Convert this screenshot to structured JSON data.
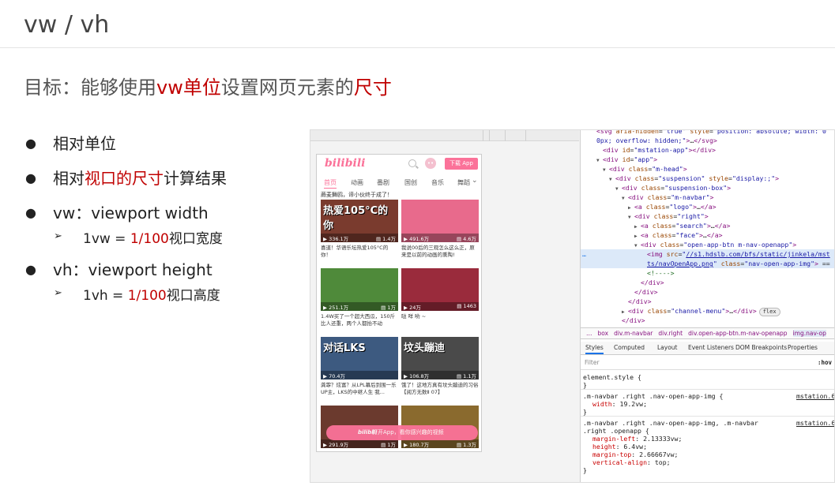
{
  "slide": {
    "title": "vw / vh",
    "goal": {
      "prefix": "目标：能够使用",
      "red1": "vw单位",
      "mid": "设置网页元素的",
      "red2": "尺寸"
    },
    "bullets": [
      {
        "dot": "●",
        "text": "相对单位"
      },
      {
        "dot": "●",
        "pre": "相对",
        "red": "视口的尺寸",
        "post": "计算结果"
      },
      {
        "dot": "●",
        "text": "vw：viewport width",
        "sub": {
          "arrow": "➢",
          "pre": "1vw = ",
          "red": "1/100",
          "post": "视口宽度"
        }
      },
      {
        "dot": "●",
        "text": "vh：viewport height",
        "sub": {
          "arrow": "➢",
          "pre": "1vh = ",
          "red": "1/100",
          "post": "视口高度"
        }
      }
    ]
  },
  "phone": {
    "logo": "bilibili",
    "face": "••",
    "download": "下载 App",
    "nav": [
      "首页",
      "动画",
      "番剧",
      "国创",
      "音乐",
      "舞蹈"
    ],
    "top_caption": "蕨麦舞鸥，谛小伙终于成了！",
    "cards": [
      {
        "big": "热爱105°C的你",
        "plays": "336.1万",
        "comments": "1.4万",
        "desc": "喜道！华语乐坛热爱105°C的你！",
        "bg": "#7a3b2e"
      },
      {
        "big": "",
        "plays": "491.6万",
        "comments": "4.6万",
        "desc": "我说00后的三观怎么这么正，原来是以前的动画的熏陶!",
        "bg": "#e86a8c"
      },
      {
        "big": "",
        "plays": "251.1万",
        "comments": "1万",
        "desc": "1.4W买了一个超大西瓜，150斤比人还重，两个人都抬不动",
        "bg": "#4f8a3a"
      },
      {
        "big": "",
        "plays": "24万",
        "comments": "1463",
        "desc": "哒 咩 哟 ~",
        "bg": "#9a2b3c"
      },
      {
        "big": "对话LKS",
        "plays": "70.4万",
        "comments": "",
        "desc": "龚霏？炫富？从LPL幕后到围一乐UP主，LKS的中继人生 我...",
        "bg": "#3d5a80"
      },
      {
        "big": "坟头蹦迪",
        "plays": "106.8万",
        "comments": "1.1万",
        "desc": "饿了！这地方真有坟头蹦迪的习俗【阅方无数Ⅱ 07】",
        "bg": "#4a4a4a"
      },
      {
        "big": "",
        "plays": "291.9万",
        "comments": "1万",
        "desc": "",
        "bg": "#6b3a2e"
      },
      {
        "big": "",
        "plays": "180.7万",
        "comments": "1.3万",
        "desc": "",
        "bg": "#8a6a2e"
      }
    ],
    "open_app": {
      "logo": "bilibili",
      "text": "打开App，看你感兴趣的视频"
    }
  },
  "devtools": {
    "tree_lines": [
      {
        "indent": 1,
        "html": "<span class='tag'>&lt;svg</span> <span class='an'>aria-hidden</span>=<span class='av'>\"true\"</span> <span class='an'>style</span>=<span class='av'>\"position: absolute; width: 0</span>"
      },
      {
        "indent": 1,
        "html": "<span class='av'>0px; overflow: hidden;\"</span><span class='tag'>&gt;</span>…<span class='tag'>&lt;/svg&gt;</span>"
      },
      {
        "indent": 2,
        "html": "<span class='tag'>&lt;div</span> <span class='an'>id</span>=<span class='av'>\"mstation-app\"</span><span class='tag'>&gt;&lt;/div&gt;</span>"
      },
      {
        "indent": 2,
        "tri": "▼",
        "html": "<span class='tag'>&lt;div</span> <span class='an'>id</span>=<span class='av'>\"app\"</span><span class='tag'>&gt;</span>"
      },
      {
        "indent": 3,
        "tri": "▼",
        "html": "<span class='tag'>&lt;div</span> <span class='an'>class</span>=<span class='av'>\"m-head\"</span><span class='tag'>&gt;</span>"
      },
      {
        "indent": 4,
        "tri": "▼",
        "html": "<span class='tag'>&lt;div</span> <span class='an'>class</span>=<span class='av'>\"suspension\"</span> <span class='an'>style</span>=<span class='av'>\"display:;\"</span><span class='tag'>&gt;</span>"
      },
      {
        "indent": 5,
        "tri": "▼",
        "html": "<span class='tag'>&lt;div</span> <span class='an'>class</span>=<span class='av'>\"suspension-box\"</span><span class='tag'>&gt;</span>"
      },
      {
        "indent": 6,
        "tri": "▼",
        "html": "<span class='tag'>&lt;div</span> <span class='an'>class</span>=<span class='av'>\"m-navbar\"</span><span class='tag'>&gt;</span>"
      },
      {
        "indent": 7,
        "tri": "▶",
        "html": "<span class='tag'>&lt;a</span> <span class='an'>class</span>=<span class='av'>\"logo\"</span><span class='tag'>&gt;</span>…<span class='tag'>&lt;/a&gt;</span>"
      },
      {
        "indent": 7,
        "tri": "▼",
        "html": "<span class='tag'>&lt;div</span> <span class='an'>class</span>=<span class='av'>\"right\"</span><span class='tag'>&gt;</span>"
      },
      {
        "indent": 8,
        "tri": "▶",
        "html": "<span class='tag'>&lt;a</span> <span class='an'>class</span>=<span class='av'>\"search\"</span><span class='tag'>&gt;</span>…<span class='tag'>&lt;/a&gt;</span>"
      },
      {
        "indent": 8,
        "tri": "▶",
        "html": "<span class='tag'>&lt;a</span> <span class='an'>class</span>=<span class='av'>\"face\"</span><span class='tag'>&gt;</span>…<span class='tag'>&lt;/a&gt;</span>"
      },
      {
        "indent": 8,
        "tri": "▼",
        "html": "<span class='tag'>&lt;div</span> <span class='an'>class</span>=<span class='av'>\"open-app-btn m-nav-openapp\"</span><span class='tag'>&gt;</span>"
      },
      {
        "indent": 9,
        "sel": true,
        "html": "<span class='tag'>&lt;img</span> <span class='an'>src</span>=<span class='av'>\"<span class='url'>//s1.hdslb.com/bfs/static/jinkela/mst</span></span>"
      },
      {
        "indent": 9,
        "sel": true,
        "html": "<span class='url'>ts/navOpenApp.png</span><span class='av'>\"</span> <span class='an'>class</span>=<span class='av'>\"nav-open-app-img\"</span><span class='tag'>&gt;</span> == $0"
      },
      {
        "indent": 9,
        "html": "<span class='cmt'>&lt;!----&gt;</span>"
      },
      {
        "indent": 8,
        "html": "<span class='tag'>&lt;/div&gt;</span>"
      },
      {
        "indent": 7,
        "html": "<span class='tag'>&lt;/div&gt;</span>"
      },
      {
        "indent": 6,
        "html": "<span class='tag'>&lt;/div&gt;</span>"
      },
      {
        "indent": 6,
        "tri": "▶",
        "html": "<span class='tag'>&lt;div</span> <span class='an'>class</span>=<span class='av'>\"channel-menu\"</span><span class='tag'>&gt;</span>…<span class='tag'>&lt;/div&gt;</span><span class='badge'>flex</span>"
      },
      {
        "indent": 5,
        "html": "<span class='tag'>&lt;/div&gt;</span>"
      },
      {
        "indent": 5,
        "html": "<span class='tag'>&lt;/div&gt;</span>"
      }
    ],
    "dots": "…",
    "breadcrumbs": [
      "…",
      "box",
      "div.m-navbar",
      "div.right",
      "div.open-app-btn.m-nav-openapp",
      "img.nav-op"
    ],
    "tabs": [
      "Styles",
      "Computed",
      "Layout",
      "Event Listeners",
      "DOM Breakpoints",
      "Properties"
    ],
    "filter_placeholder": "Filter",
    "hov": ":hov",
    "rules": [
      {
        "sel": "element.style {"
      },
      {
        "close": "}"
      },
      {
        "sel": ".m-navbar .right .nav-open-app-img {",
        "src": "mstation.6"
      },
      {
        "prop": "width",
        "val": "19.2vw;"
      },
      {
        "close": "}"
      },
      {
        "sel": ".m-navbar .right .nav-open-app-img, .m-navbar",
        "src": "mstation.6"
      },
      {
        "sel": ".right .openapp {"
      },
      {
        "prop": "margin-left",
        "val": "2.13333vw;"
      },
      {
        "prop": "height",
        "val": "6.4vw;"
      },
      {
        "prop": "margin-top",
        "val": "2.66667vw;"
      },
      {
        "prop": "vertical-align",
        "val": "top;"
      },
      {
        "close": "}"
      }
    ]
  }
}
